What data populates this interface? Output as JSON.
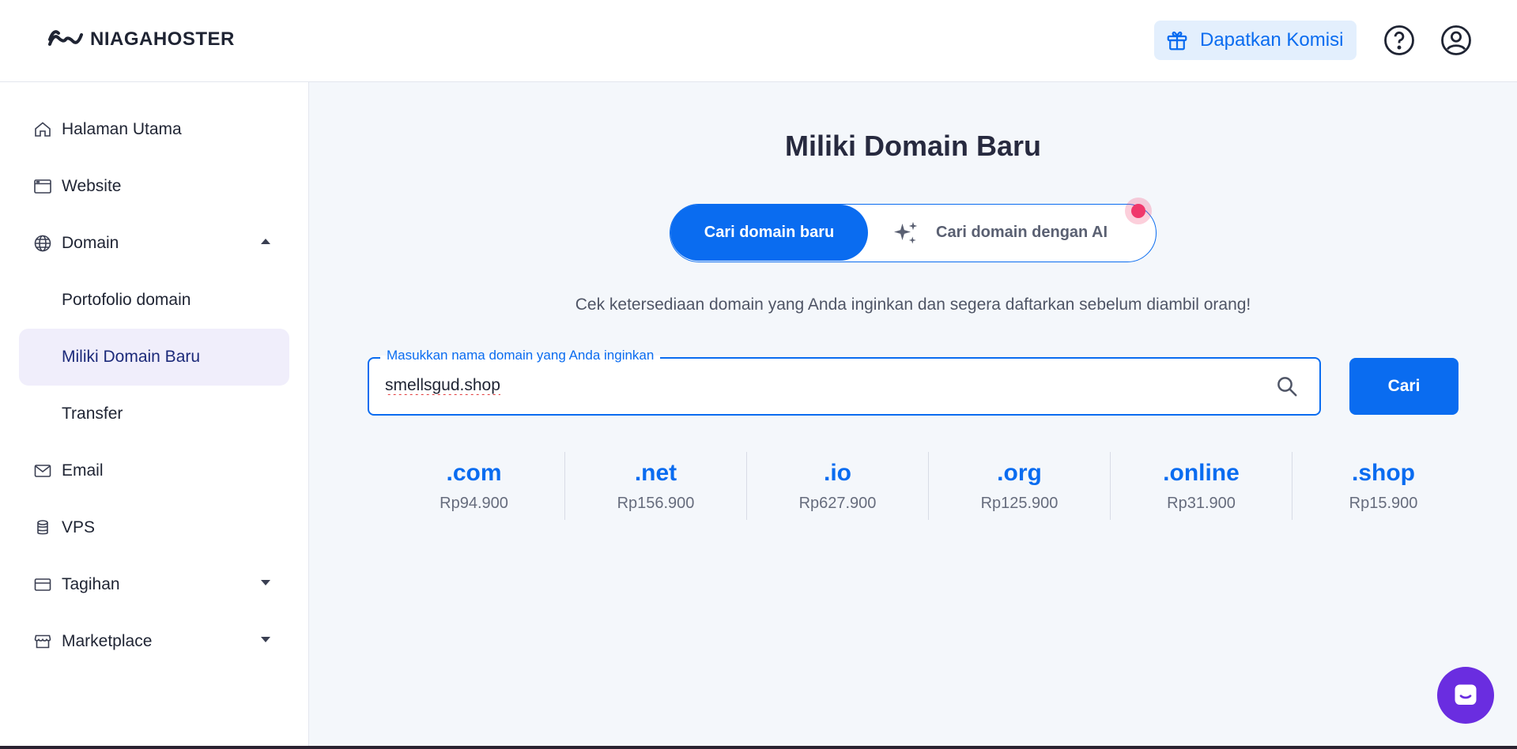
{
  "header": {
    "logo_text": "NIAGAHOSTER",
    "komisi_label": "Dapatkan Komisi"
  },
  "sidebar": {
    "items": [
      {
        "label": "Halaman Utama",
        "icon": "home-icon"
      },
      {
        "label": "Website",
        "icon": "browser-window-icon"
      },
      {
        "label": "Domain",
        "icon": "globe-icon",
        "expanded": true
      },
      {
        "label": "Portofolio domain"
      },
      {
        "label": "Miliki Domain Baru",
        "active": true
      },
      {
        "label": "Transfer"
      },
      {
        "label": "Email",
        "icon": "mail-icon"
      },
      {
        "label": "VPS",
        "icon": "database-icon"
      },
      {
        "label": "Tagihan",
        "icon": "credit-card-icon",
        "expanded": false
      },
      {
        "label": "Marketplace",
        "icon": "store-icon",
        "expanded": false
      }
    ]
  },
  "main": {
    "title": "Miliki Domain Baru",
    "toggle": {
      "active_label": "Cari domain baru",
      "ai_label": "Cari domain dengan AI"
    },
    "subtitle": "Cek ketersediaan domain yang Anda inginkan dan segera daftarkan sebelum diambil orang!",
    "search": {
      "label": "Masukkan nama domain yang Anda inginkan",
      "value": "smellsgud.shop"
    },
    "search_button": "Cari",
    "tlds": [
      {
        "name": ".com",
        "price": "Rp94.900"
      },
      {
        "name": ".net",
        "price": "Rp156.900"
      },
      {
        "name": ".io",
        "price": "Rp627.900"
      },
      {
        "name": ".org",
        "price": "Rp125.900"
      },
      {
        "name": ".online",
        "price": "Rp31.900"
      },
      {
        "name": ".shop",
        "price": "Rp15.900"
      }
    ]
  },
  "colors": {
    "primary": "#0a6cf0",
    "active_bg": "#f0eefb",
    "chat": "#6a2de0"
  }
}
